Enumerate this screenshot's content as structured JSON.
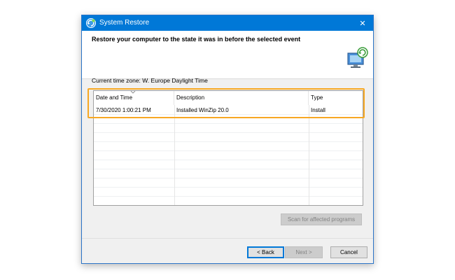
{
  "window": {
    "title": "System Restore",
    "close_glyph": "✕"
  },
  "header": {
    "instruction": "Restore your computer to the state it was in before the selected event",
    "icon": "monitor-restore-icon"
  },
  "timezone_label": "Current time zone: W. Europe Daylight Time",
  "restore_points": {
    "columns": [
      "Date and Time",
      "Description",
      "Type"
    ],
    "sort_column": "Date and Time",
    "rows": [
      {
        "date_time": "7/30/2020 1:00:21 PM",
        "description": "Installed WinZip 20.0",
        "type": "Install"
      }
    ]
  },
  "buttons": {
    "scan": "Scan for affected programs",
    "back": "< Back",
    "next": "Next >",
    "cancel": "Cancel"
  },
  "colors": {
    "titlebar": "#0078d7",
    "highlight": "#f7a823"
  }
}
